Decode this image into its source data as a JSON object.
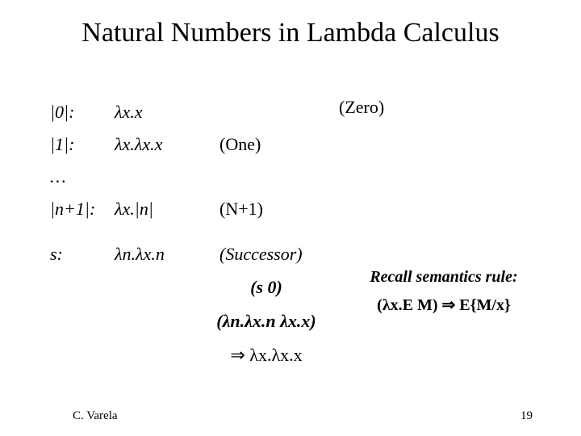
{
  "title": "Natural Numbers in Lambda Calculus",
  "defs": {
    "zero": {
      "label": "|0|:",
      "expr": "λx.x",
      "name": "(Zero)"
    },
    "one": {
      "label": "|1|:",
      "expr": "λx.λx.x",
      "name": "(One)"
    },
    "dots": {
      "label": "…",
      "expr": "",
      "name": ""
    },
    "np1": {
      "label": "|n+1|:",
      "expr": "λx.|n|",
      "name": "(N+1)"
    },
    "succ": {
      "label": "s:",
      "expr": "λn.λx.n",
      "name": "(Successor)"
    }
  },
  "derivation": {
    "line1": "(s 0)",
    "line2": "(λn.λx.n λx.x)",
    "line3_prefix": "⇒ ",
    "line3_expr": "λx.λx.x"
  },
  "recall": {
    "title": "Recall semantics rule:",
    "body": "(λx.E M)  ⇒  E{M/x}"
  },
  "footer": {
    "author": "C. Varela",
    "page": "19"
  }
}
